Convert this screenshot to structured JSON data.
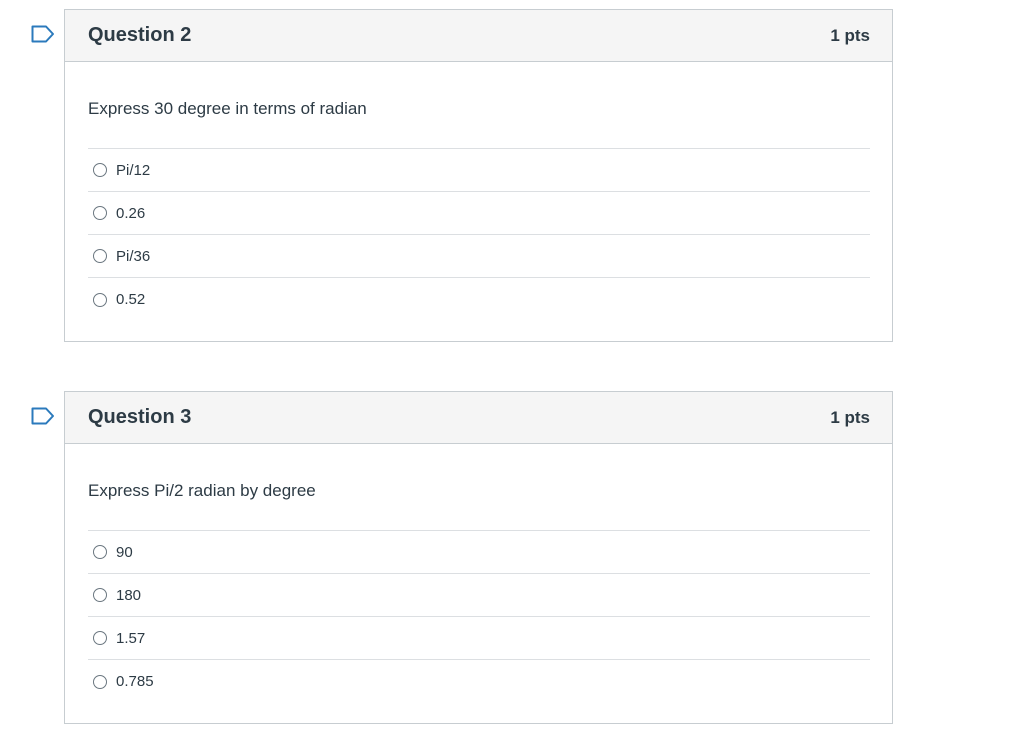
{
  "questions": [
    {
      "title": "Question 2",
      "points": "1 pts",
      "text": "Express 30 degree in terms of radian",
      "answers": [
        "Pi/12",
        "0.26",
        "Pi/36",
        "0.52"
      ]
    },
    {
      "title": "Question 3",
      "points": "1 pts",
      "text": "Express Pi/2 radian by degree",
      "answers": [
        "90",
        "180",
        "1.57",
        "0.785"
      ]
    }
  ],
  "colors": {
    "flag": "#2b7abc",
    "header_bg": "#f5f5f5",
    "border": "#c7cdd1",
    "text": "#2d3b45"
  },
  "icons": {
    "flag": "flag-question-icon",
    "radio": "radio-button-icon"
  }
}
